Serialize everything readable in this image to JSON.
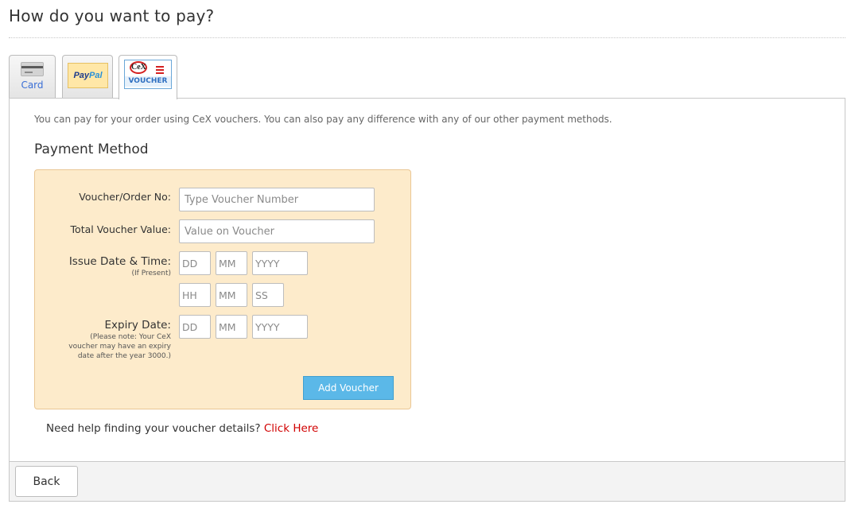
{
  "page_title": "How do you want to pay?",
  "tabs": {
    "card": {
      "label": "Card",
      "icon": "credit-card-icon"
    },
    "paypal": {
      "pay": "Pay",
      "pal": "Pal",
      "icon": "paypal-logo"
    },
    "voucher": {
      "badge": "CeX",
      "label": "VOUCHER",
      "icon": "cex-voucher-logo",
      "active": true
    }
  },
  "intro_text": "You can pay for your order using CeX vouchers. You can also pay any difference with any of our other payment methods.",
  "section_title": "Payment Method",
  "form": {
    "voucher_no_label": "Voucher/Order No:",
    "voucher_no_placeholder": "Type Voucher Number",
    "total_value_label": "Total Voucher Value:",
    "total_value_placeholder": "Value on Voucher",
    "issue_label": "Issue Date & Time:",
    "issue_sub": "(If Present)",
    "issue_dd": "DD",
    "issue_mm": "MM",
    "issue_yyyy": "YYYY",
    "issue_hh": "HH",
    "issue_min": "MM",
    "issue_ss": "SS",
    "expiry_label": "Expiry Date:",
    "expiry_note_1": "(Please note: Your CeX",
    "expiry_note_2": "voucher may have an expiry",
    "expiry_note_3": "date after the year 3000.)",
    "expiry_dd": "DD",
    "expiry_mm": "MM",
    "expiry_yyyy": "YYYY",
    "add_button": "Add Voucher"
  },
  "help": {
    "text": "Need help finding your voucher details?",
    "link": "Click Here"
  },
  "footer": {
    "back_button": "Back"
  },
  "colors": {
    "voucher_box_bg": "#fdebcb",
    "add_button_bg": "#5bb8e8",
    "link_red": "#d10000",
    "tab_link_blue": "#3a6fd6"
  }
}
